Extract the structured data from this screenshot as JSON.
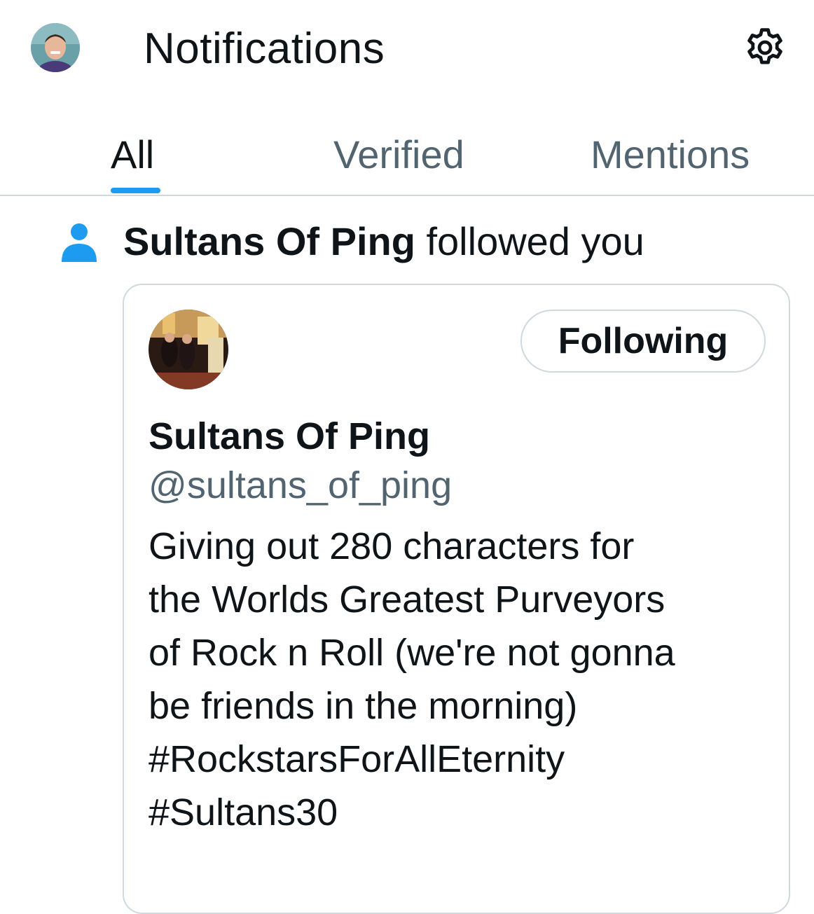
{
  "header": {
    "title": "Notifications",
    "avatar_icon": "user-avatar-icon",
    "settings_icon": "gear-icon"
  },
  "tabs": [
    {
      "label": "All",
      "active": true
    },
    {
      "label": "Verified",
      "active": false
    },
    {
      "label": "Mentions",
      "active": false
    }
  ],
  "colors": {
    "accent": "#1d9bf0",
    "text_primary": "#0f1419",
    "text_secondary": "#536471",
    "border": "#cfd9de"
  },
  "notification": {
    "icon": "person-icon",
    "actor": "Sultans Of Ping",
    "action": " followed you",
    "card": {
      "name": "Sultans Of Ping",
      "handle": "@sultans_of_ping",
      "follow_button_label": "Following",
      "bio_lines": [
        "Giving out 280 characters for",
        "the Worlds Greatest Purveyors",
        "of Rock n Roll (we're not gonna",
        "be friends in the morning)",
        "#RockstarsForAllEternity",
        "#Sultans30"
      ]
    }
  }
}
